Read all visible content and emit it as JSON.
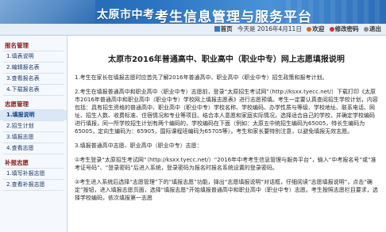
{
  "header": {
    "brand": "太原市中考",
    "platform_title": "考生信息管理与服务平台"
  },
  "topbar": {
    "home": "首页",
    "date": "今天是 2016年4月11日",
    "user": "欢迎",
    "change_password": "修改密码",
    "logout": "退出"
  },
  "sidebar": {
    "groups": [
      {
        "label": "报名管理",
        "items": [
          "1.填表说明",
          "2.编辑报名表",
          "3.查看报名表",
          "4.下载报名表"
        ]
      },
      {
        "label": "志愿管理",
        "items": [
          "1.填报说明",
          "2.招生计划",
          "3.填报志愿",
          "4.查看志愿"
        ]
      },
      {
        "label": "补报志愿",
        "items": [
          "1.填写补报志愿",
          "2.查看补报志愿"
        ]
      }
    ],
    "active_item": "1.填报说明"
  },
  "main": {
    "title": "太原市2016年普通高中、职业高中（职业中专）网上志愿填报说明",
    "para1": "1.考生在家长在填报志愿时应首先了解2016年普通高中、职业高中（职业中专）招生政策和报考计划。",
    "para2": "2.考生在填报普通高中和职业高中（职业中专）志愿前，登录“太原招生考试网”（http://ksxx.tyecc.net/）下载打印《太原市2016年普通高中和职业高中（职业中专）学校网上填报志愿表》进行志愿预填。考生一定要认真查阅招生学校计划，内容包括：具有招生资格的普通高中、职业高中（职业中专）学校名称、学校编码、办学性质与等级、学校地址、联系电话、网址、招生人数、收费标准、住宿情况和专业等项目。结合本人意愿和家庭实际情况，选择适合自己的学校，并确定学校编码进行填报，同一所学校招生计划有两个编码的，学校编码在下面（例如：太原五中统招生编码为65005，特长生编码为65005，定向生编码为：65905，国际课程班编码为65705等），考生和家长要特别注意，以避免填报无效志愿。",
    "para3": "3.填报普通高中志愿、职业高中（职业中专）志愿：",
    "para4": "①考生登录“太原招生考试网”（http://ksxx.tyecc.net/）“2016年中考考生信息管理与服务平台”，输入“中考报名号”或“准考证号码”、“登录密码”后进入系统，登录密码为报名时报名系统设置的登录密码。",
    "para5": "②考生进入系统后选择“志愿管理”下的“填报志愿”功能，弹出“志愿填报说明”对话框，仔细阅读“志愿填报说明”，点击“确定”按钮，进入填报志愿页面，选择“填报志愿”开始填报普通高中和职业高中（职业中专）志愿。考生按照志愿栏目要求，选择学校编码，依次填报第一志愿"
  }
}
